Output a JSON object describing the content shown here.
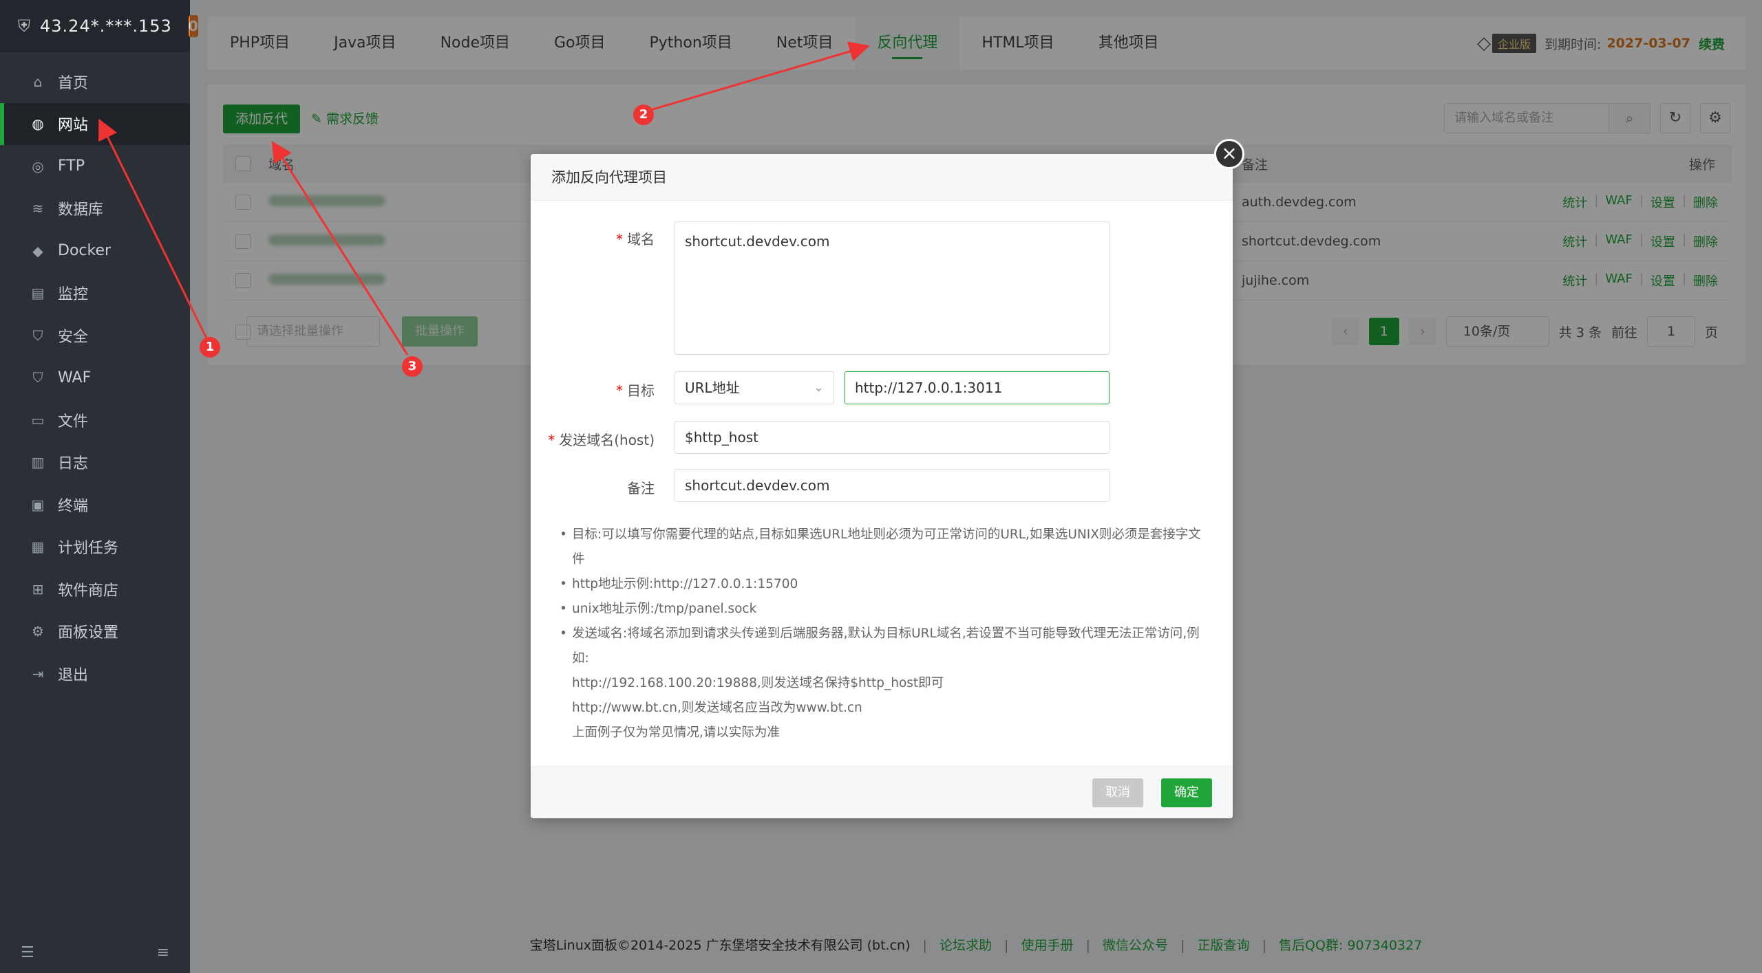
{
  "sidebar": {
    "ip": "43.24*.***.153",
    "badge": "0",
    "items": [
      {
        "label": "首页",
        "icon": "home-icon"
      },
      {
        "label": "网站",
        "icon": "globe-icon"
      },
      {
        "label": "FTP",
        "icon": "globe-icon"
      },
      {
        "label": "数据库",
        "icon": "database-icon"
      },
      {
        "label": "Docker",
        "icon": "docker-icon"
      },
      {
        "label": "监控",
        "icon": "monitor-icon"
      },
      {
        "label": "安全",
        "icon": "shield-icon"
      },
      {
        "label": "WAF",
        "icon": "shield-icon"
      },
      {
        "label": "文件",
        "icon": "folder-icon"
      },
      {
        "label": "日志",
        "icon": "log-icon"
      },
      {
        "label": "终端",
        "icon": "terminal-icon"
      },
      {
        "label": "计划任务",
        "icon": "calendar-icon"
      },
      {
        "label": "软件商店",
        "icon": "grid-icon"
      },
      {
        "label": "面板设置",
        "icon": "gear-icon"
      },
      {
        "label": "退出",
        "icon": "logout-icon"
      }
    ]
  },
  "tabs": [
    "PHP项目",
    "Java项目",
    "Node项目",
    "Go项目",
    "Python项目",
    "Net项目",
    "反向代理",
    "HTML项目",
    "其他项目"
  ],
  "license": {
    "edition": "企业版",
    "expire_label": "到期时间:",
    "expire_date": "2027-03-07",
    "renew": "续费"
  },
  "toolbar": {
    "add_label": "添加反代",
    "feedback_label": "需求反馈",
    "search_placeholder": "请输入域名或备注"
  },
  "table": {
    "head_domain": "域名",
    "head_remark": "备注",
    "head_ops": "操作",
    "rows": [
      {
        "remark": "auth.devdeg.com"
      },
      {
        "remark": "shortcut.devdeg.com"
      },
      {
        "remark": "jujihe.com"
      }
    ],
    "ops": [
      "统计",
      "WAF",
      "设置",
      "删除"
    ]
  },
  "batch": {
    "select_placeholder": "请选择批量操作",
    "button": "批量操作"
  },
  "pager": {
    "page": "1",
    "size": "10条/页",
    "total": "共 3 条",
    "goto_label": "前往",
    "goto_value": "1",
    "page_unit": "页"
  },
  "modal": {
    "title": "添加反向代理项目",
    "fields": {
      "domain_label": "域名",
      "domain_value": "shortcut.devdev.com",
      "target_label": "目标",
      "target_type": "URL地址",
      "target_url": "http://127.0.0.1:3011",
      "host_label": "发送域名(host)",
      "host_value": "$http_host",
      "remark_label": "备注",
      "remark_value": "shortcut.devdev.com"
    },
    "notes": [
      "目标:可以填写你需要代理的站点,目标如果选URL地址则必须为可正常访问的URL,如果选UNIX则必须是套接字文件",
      "http地址示例:http://127.0.0.1:15700",
      "unix地址示例:/tmp/panel.sock",
      "发送域名:将域名添加到请求头传递到后端服务器,默认为目标URL域名,若设置不当可能导致代理无法正常访问,例如:"
    ],
    "note_subs": [
      "http://192.168.100.20:19888,则发送域名保持$http_host即可",
      "http://www.bt.cn,则发送域名应当改为www.bt.cn",
      "上面例子仅为常见情况,请以实际为准"
    ],
    "cancel": "取消",
    "ok": "确定"
  },
  "markers": [
    "1",
    "2",
    "3"
  ],
  "footer": {
    "copyright": "宝塔Linux面板©2014-2025 广东堡塔安全技术有限公司 (bt.cn)",
    "links": [
      "论坛求助",
      "使用手册",
      "微信公众号",
      "正版查询"
    ],
    "qq": "售后QQ群: 907340327"
  }
}
